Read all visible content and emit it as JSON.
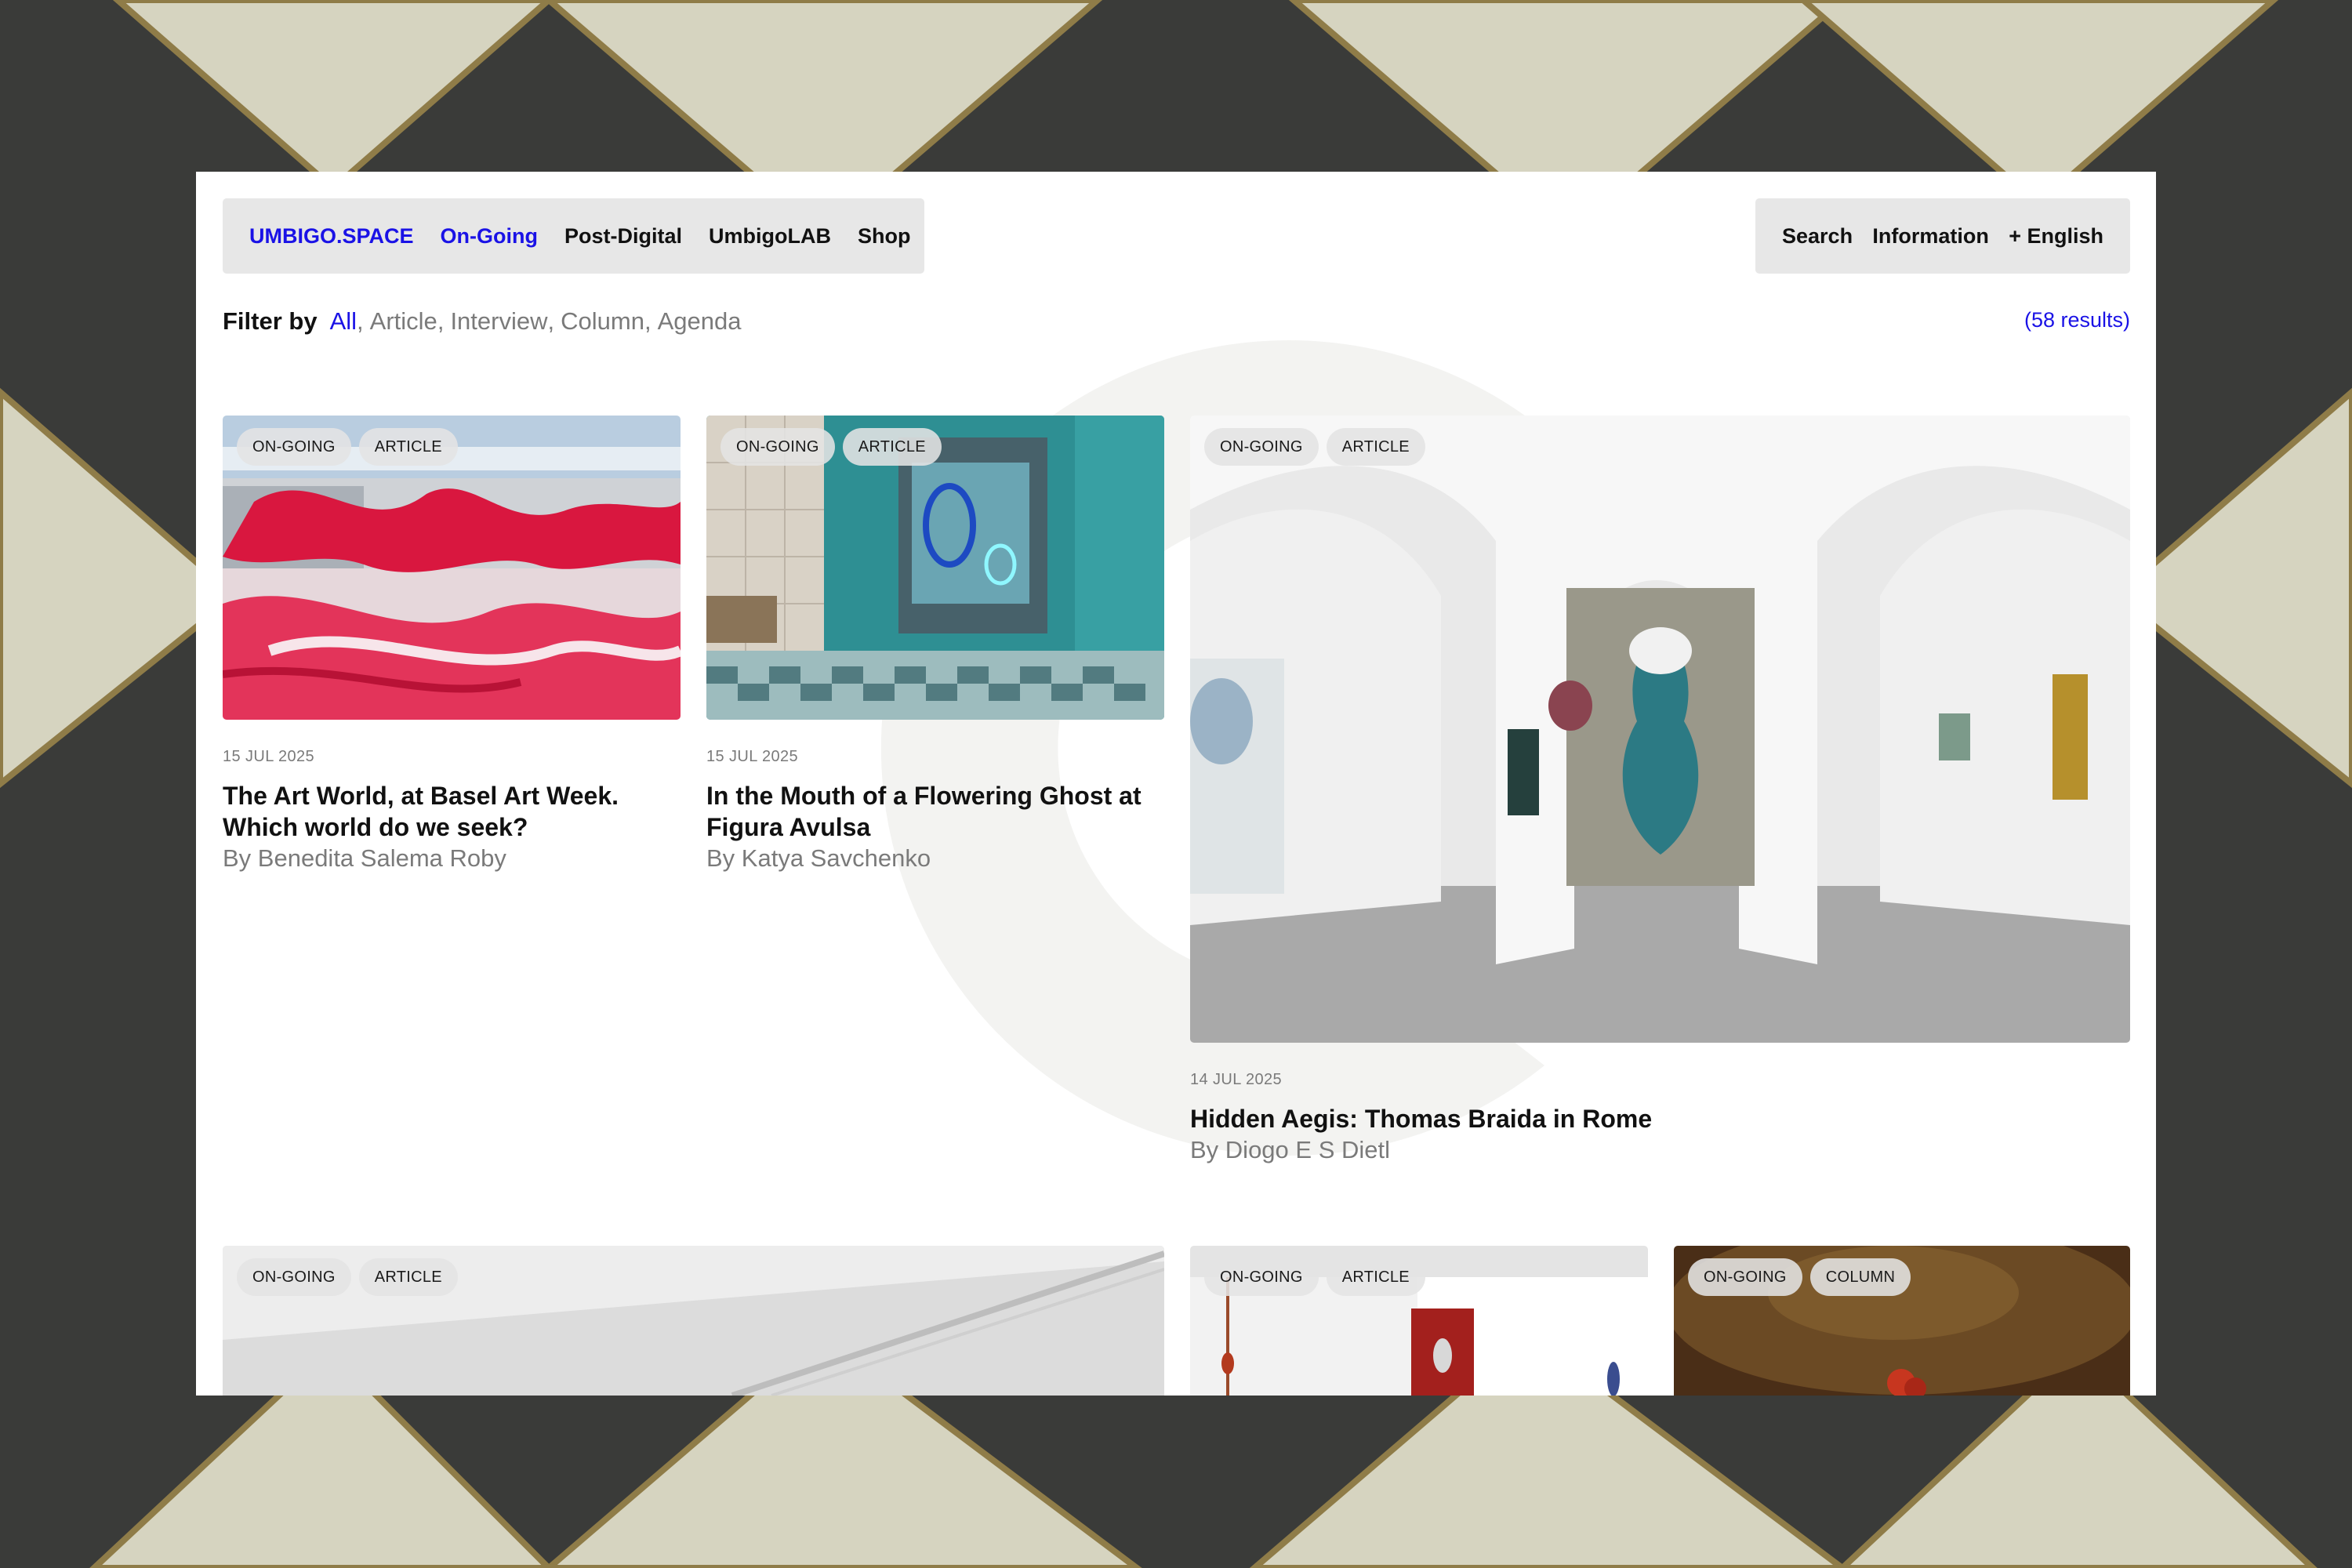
{
  "nav": {
    "left": [
      "UMBIGO.SPACE",
      "On-Going",
      "Post-Digital",
      "UmbigoLAB",
      "Shop"
    ],
    "right": [
      "Search",
      "Information",
      "+ English"
    ]
  },
  "filter": {
    "label": "Filter by",
    "options": [
      "All",
      "Article",
      "Interview",
      "Column",
      "Agenda"
    ],
    "results": "(58 results)"
  },
  "articles": [
    {
      "tags": [
        "ON-GOING",
        "ARTICLE"
      ],
      "date": "15 JUL 2025",
      "title": "The Art World, at Basel Art Week. Which world do we seek?",
      "author": "By Benedita Salema Roby"
    },
    {
      "tags": [
        "ON-GOING",
        "ARTICLE"
      ],
      "date": "15 JUL 2025",
      "title": "In the Mouth of a Flowering Ghost at Figura Avulsa",
      "author": "By Katya Savchenko"
    },
    {
      "tags": [
        "ON-GOING",
        "ARTICLE"
      ],
      "date": "14 JUL 2025",
      "title": "Hidden Aegis: Thomas Braida in Rome",
      "author": "By Diogo E S Dietl"
    },
    {
      "tags": [
        "ON-GOING",
        "ARTICLE"
      ]
    },
    {
      "tags": [
        "ON-GOING",
        "ARTICLE"
      ]
    },
    {
      "tags": [
        "ON-GOING",
        "COLUMN"
      ]
    }
  ]
}
